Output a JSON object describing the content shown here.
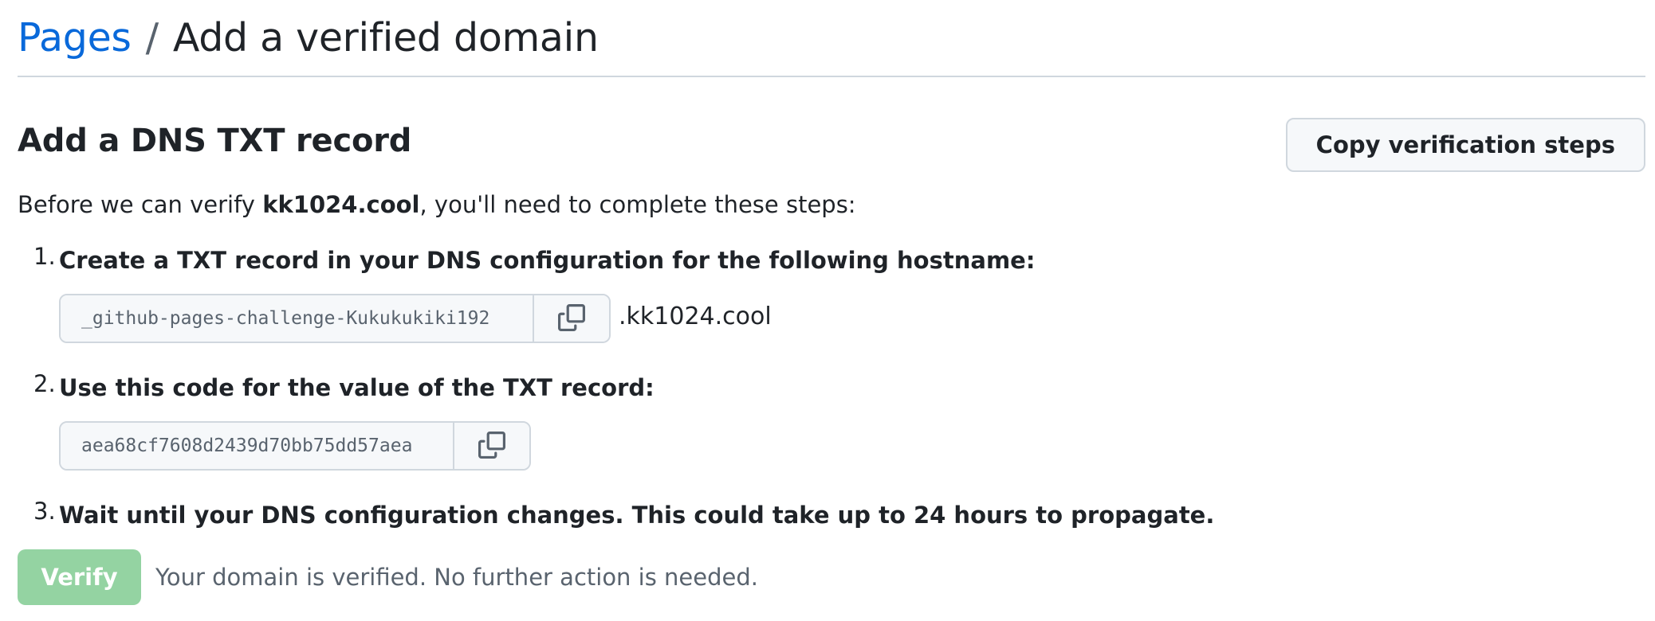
{
  "breadcrumb": {
    "parent": "Pages",
    "separator": "/",
    "current": "Add a verified domain"
  },
  "section": {
    "title": "Add a DNS TXT record",
    "copy_button": "Copy verification steps"
  },
  "intro": {
    "prefix": "Before we can verify ",
    "domain": "kk1024.cool",
    "suffix": ", you'll need to complete these steps:"
  },
  "steps": [
    {
      "number": "1.",
      "text": "Create a TXT record in your DNS configuration for the following hostname:",
      "value": "_github-pages-challenge-Kukukukiki192",
      "suffix": ".kk1024.cool",
      "copy_icon": "copy-icon"
    },
    {
      "number": "2.",
      "text": "Use this code for the value of the TXT record:",
      "value": "aea68cf7608d2439d70bb75dd57aea",
      "copy_icon": "copy-icon"
    },
    {
      "number": "3.",
      "text": "Wait until your DNS configuration changes. This could take up to 24 hours to propagate."
    }
  ],
  "verify": {
    "button": "Verify",
    "message": "Your domain is verified. No further action is needed.",
    "disabled": true
  },
  "colors": {
    "link": "#0969da",
    "verify_bg": "#94d3a2",
    "border": "#d0d7de",
    "muted": "#59636e"
  }
}
